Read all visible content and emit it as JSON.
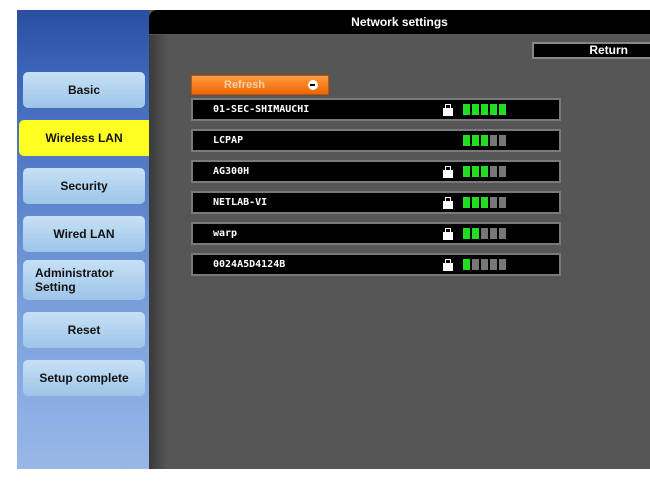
{
  "window": {
    "title": "Network settings"
  },
  "toolbar": {
    "return_label": "Return",
    "refresh_label": "Refresh"
  },
  "sidebar": {
    "items": [
      {
        "label": "Basic",
        "active": false
      },
      {
        "label": "Wireless LAN",
        "active": true
      },
      {
        "label": "Security",
        "active": false
      },
      {
        "label": "Wired LAN",
        "active": false
      },
      {
        "label": "Administrator Setting",
        "active": false
      },
      {
        "label": "Reset",
        "active": false
      },
      {
        "label": "Setup complete",
        "active": false
      }
    ]
  },
  "networks": [
    {
      "ssid": "01-SEC-SHIMAUCHI",
      "secured": true,
      "signal": 5
    },
    {
      "ssid": "LCPAP",
      "secured": false,
      "signal": 3
    },
    {
      "ssid": "AG300H",
      "secured": true,
      "signal": 3
    },
    {
      "ssid": "NETLAB-VI",
      "secured": true,
      "signal": 3
    },
    {
      "ssid": "warp",
      "secured": true,
      "signal": 2
    },
    {
      "ssid": "0024A5D4124B",
      "secured": true,
      "signal": 1
    }
  ],
  "signal_max": 5,
  "colors": {
    "active_menu": "#ffff22",
    "signal_on": "#22dd22",
    "signal_off": "#777777",
    "refresh": "#ff7a1a"
  }
}
